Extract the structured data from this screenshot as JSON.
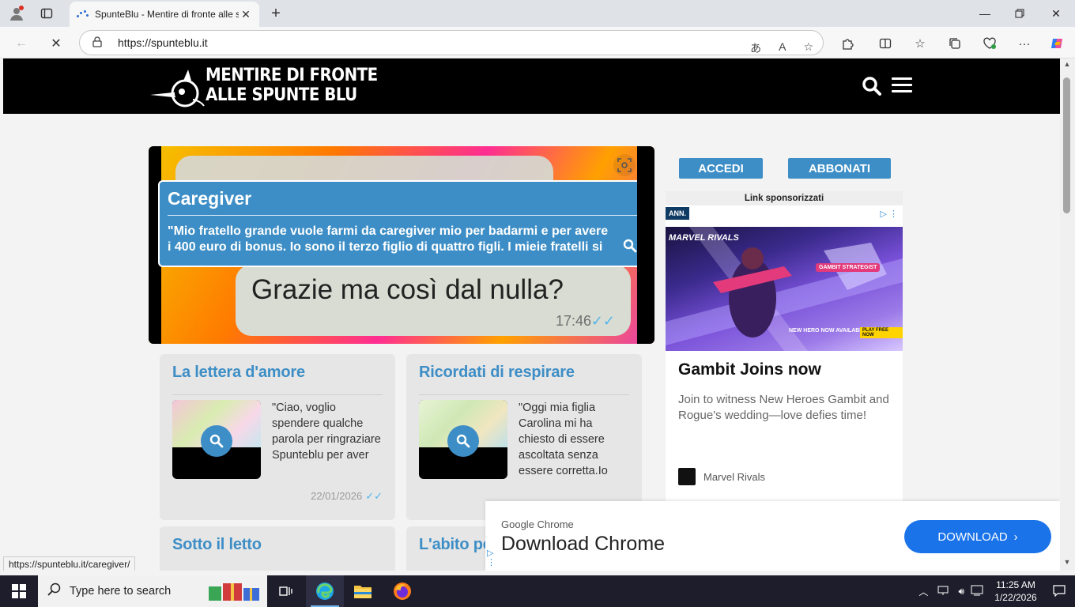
{
  "browser": {
    "tab_title": "SpunteBlu - Mentire di fronte alle spunte blu",
    "url": "https://spunteblu.it",
    "status_url": "https://spunteblu.it/caregiver/"
  },
  "site": {
    "logo_line1": "MENTIRE DI FRONTE",
    "logo_line2": "ALLE SPUNTE BLU"
  },
  "hero": {
    "title": "Caregiver",
    "excerpt": "\"Mio fratello grande vuole farmi da caregiver mio per badarmi e per avere i 400 euro di bonus. Io sono il terzo figlio di quattro figli. I mieie fratelli si [...]",
    "bubble_text": "Grazie ma così dal nulla?",
    "bubble_time": "17:46"
  },
  "cards": [
    {
      "title": "La lettera d'amore",
      "excerpt": "\"Ciao, voglio spendere qualche parola per ringraziare Spunteblu per aver",
      "date": "22/01/2026"
    },
    {
      "title": "Ricordati di respirare",
      "excerpt": "\"Oggi mia figlia Carolina mi ha chiesto di essere ascoltata senza essere corretta.Io",
      "date": ""
    },
    {
      "title": "Sotto il letto"
    },
    {
      "title": "L'abito pe"
    }
  ],
  "sidebar": {
    "login_label": "ACCEDI",
    "subscribe_label": "ABBONATI",
    "ad": {
      "header": "Link sponsorizzati",
      "badge": "ANN.",
      "headline": "Gambit Joins now",
      "description": "Join to witness New Heroes Gambit and Rogue's wedding—love defies time!",
      "brand": "Marvel Rivals",
      "image_game_logo": "MARVEL RIVALS",
      "image_caption": "NEW HERO NOW AVAILABLE",
      "image_cta": "PLAY FREE NOW",
      "image_tag": "GAMBIT STRATEGIST"
    }
  },
  "promo": {
    "brand": "Google Chrome",
    "title": "Download Chrome",
    "button": "DOWNLOAD"
  },
  "taskbar": {
    "search_placeholder": "Type here to search",
    "time": "11:25 AM",
    "date": "1/22/2026"
  },
  "colors": {
    "accent": "#3d8ec6",
    "header_bg": "#000000",
    "chrome_blue": "#1a73e8"
  }
}
